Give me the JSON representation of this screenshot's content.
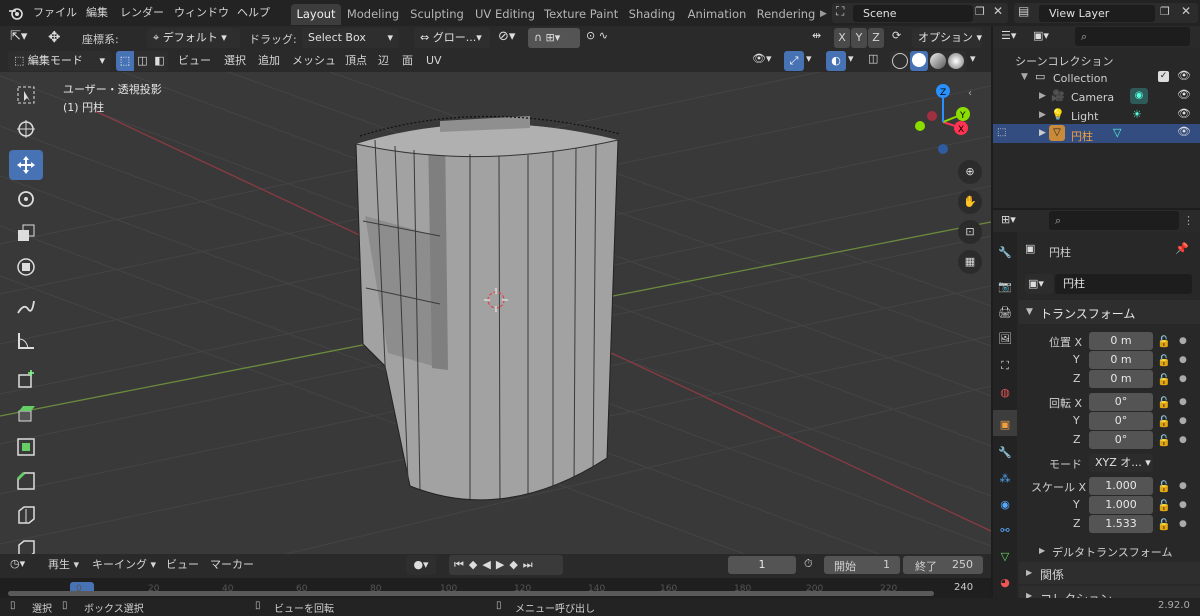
{
  "menu": {
    "file": "ファイル",
    "edit": "編集",
    "render": "レンダー",
    "window": "ウィンドウ",
    "help": "ヘルプ"
  },
  "workspaces": [
    "Layout",
    "Modeling",
    "Sculpting",
    "UV Editing",
    "Texture Paint",
    "Shading",
    "Animation",
    "Rendering"
  ],
  "scene": {
    "name": "Scene"
  },
  "view_layer": {
    "name": "View Layer"
  },
  "tool_header": {
    "coord_label": "座標系:",
    "coord_value": "デフォルト",
    "drag_label": "ドラッグ:",
    "drag_value": "Select Box",
    "transform_orient": "グロー...",
    "axes": [
      "X",
      "Y",
      "Z"
    ],
    "options": "オプション"
  },
  "viewport_header": {
    "mode": "編集モード",
    "menus": [
      "ビュー",
      "選択",
      "追加",
      "メッシュ",
      "頂点",
      "辺",
      "面",
      "UV"
    ]
  },
  "viewport": {
    "view_name": "ユーザー・透視投影",
    "object_name": "(1) 円柱",
    "gizmo_axes": {
      "x": "X",
      "y": "Y",
      "z": "Z"
    }
  },
  "outliner": {
    "root": "シーンコレクション",
    "collection": "Collection",
    "items": [
      "Camera",
      "Light",
      "円柱"
    ]
  },
  "properties": {
    "object_title": "円柱",
    "object_name_field": "円柱",
    "panel_transform": "トランスフォーム",
    "location_label": "位置",
    "rotation_label": "回転",
    "mode_label": "モード",
    "scale_label": "スケール",
    "axis_x": "X",
    "axis_y": "Y",
    "axis_z": "Z",
    "location": [
      "0 m",
      "0 m",
      "0 m"
    ],
    "rotation": [
      "0°",
      "0°",
      "0°"
    ],
    "mode_value": "XYZ オ...",
    "scale": [
      "1.000",
      "1.000",
      "1.533"
    ],
    "delta_transform": "デルタトランスフォーム",
    "relations": "関係",
    "collection": "コレクション"
  },
  "timeline": {
    "playback": "再生",
    "keying": "キーイング",
    "view": "ビュー",
    "marker": "マーカー",
    "current_frame": "1",
    "start_label": "開始",
    "start_value": "1",
    "end_label": "終了",
    "end_value": "250",
    "ruler": [
      "0",
      "20",
      "40",
      "60",
      "80",
      "100",
      "120",
      "140",
      "160",
      "180",
      "200",
      "220",
      "240"
    ]
  },
  "statusbar": {
    "select": "選択",
    "box_select": "ボックス選択",
    "rotate_view": "ビューを回転",
    "call_menu": "メニュー呼び出し",
    "version": "2.92.0"
  },
  "colors": {
    "accent": "#4772b3",
    "x_axis": "#ff3352",
    "y_axis": "#8bdc00",
    "z_axis": "#2890ff",
    "selected_row": "#334d80"
  }
}
